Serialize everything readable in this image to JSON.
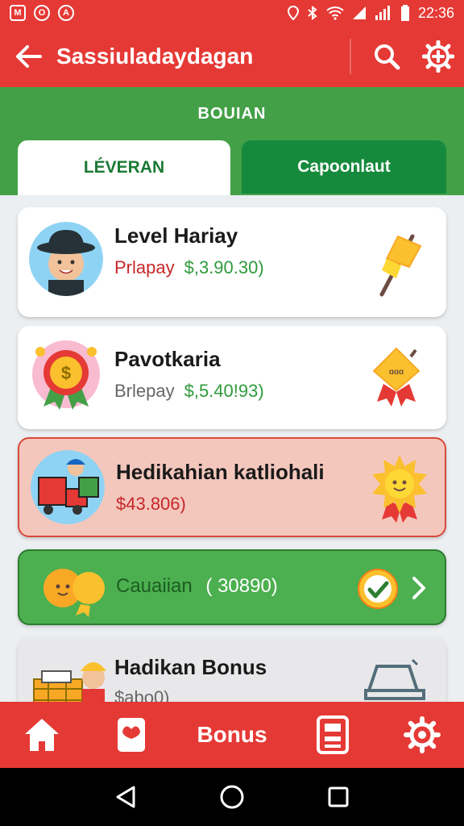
{
  "status_bar": {
    "time": "22:36"
  },
  "app_bar": {
    "title": "Sassiuladaydagan"
  },
  "section": {
    "title": "BOUIAN"
  },
  "tabs": [
    {
      "label": "LÉVERAN"
    },
    {
      "label": "Capoonlaut"
    }
  ],
  "cards": [
    {
      "title": "Level Hariay",
      "subtitle_label": "Prlapay",
      "subtitle_value": "$,3.90.30)"
    },
    {
      "title": "Pavotkaria",
      "subtitle_label": "Brlepay",
      "subtitle_value": "$,5.40!93)"
    },
    {
      "title": "Hedikahian katliohali",
      "subtitle_value": "$43.806)"
    },
    {
      "title": "Cauaiian",
      "subtitle_value": "( 30890)"
    },
    {
      "title": "Hadikan Bonus",
      "subtitle_value": "$abo0)"
    }
  ],
  "bottom_nav": {
    "active_label": "Bonus"
  },
  "colors": {
    "brand_red": "#e53935",
    "brand_green": "#43a047",
    "dark_green": "#168a3c",
    "highlight_card": "#f4c7bd"
  }
}
